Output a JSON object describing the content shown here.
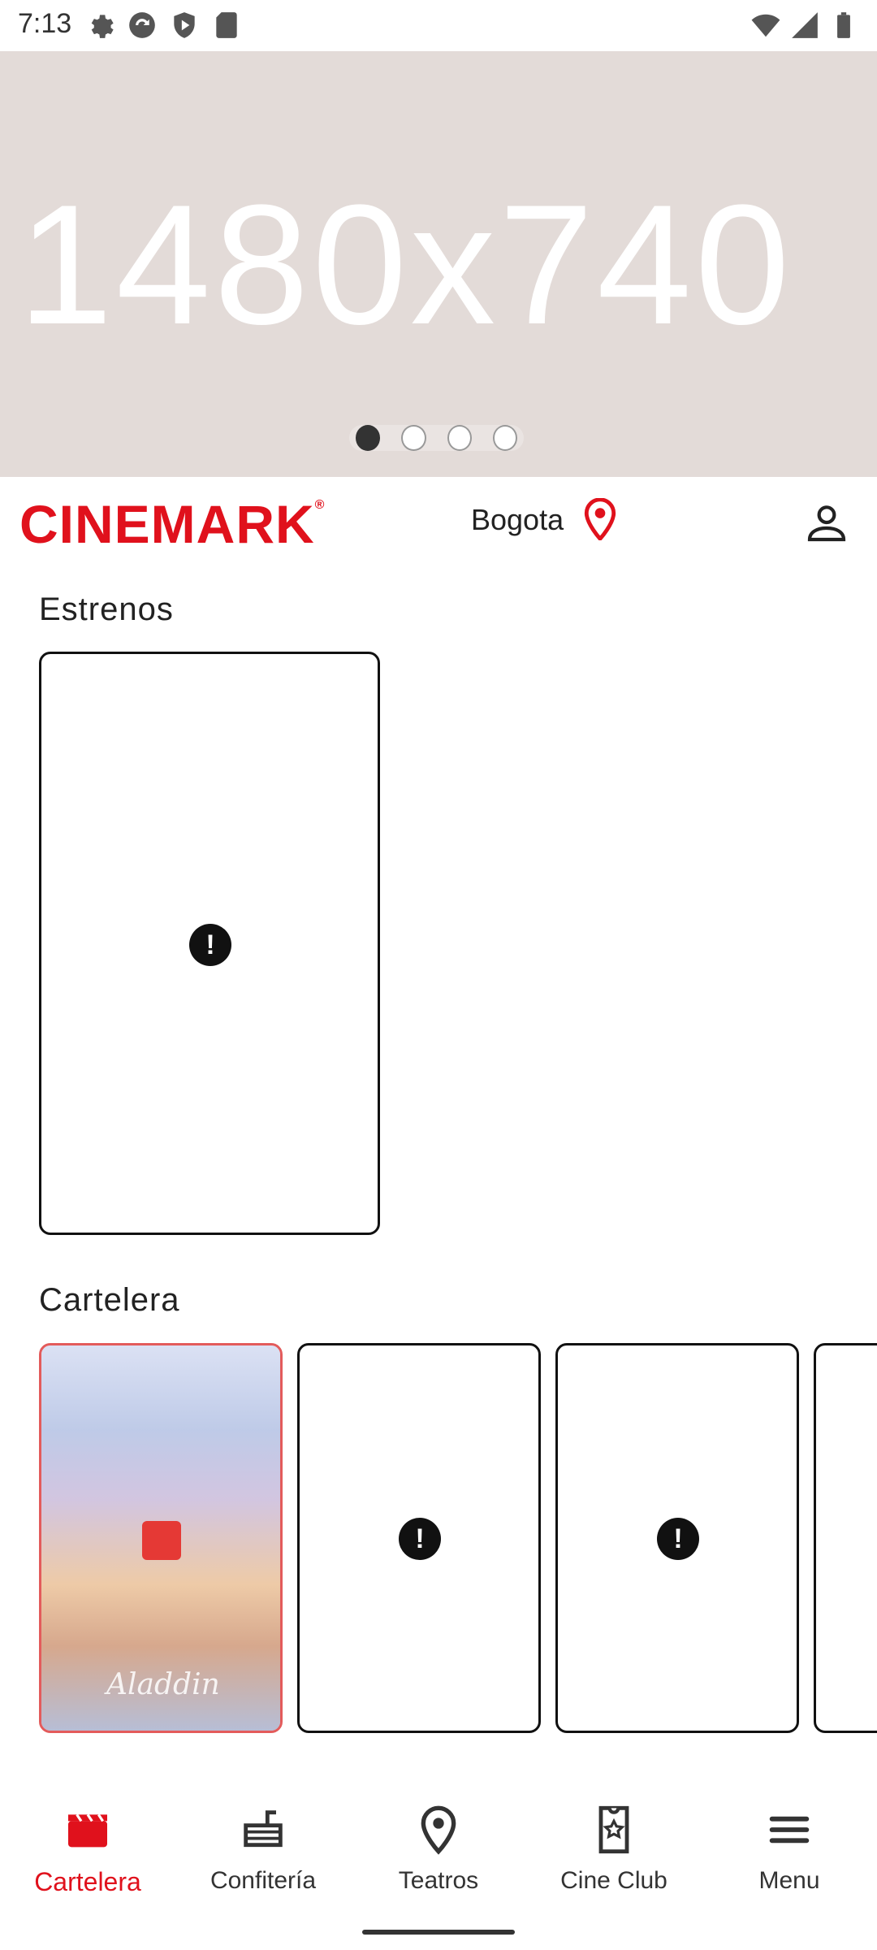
{
  "status": {
    "time": "7:13",
    "left_icons": [
      "gear-icon",
      "sync-icon",
      "shield-play-icon",
      "sd-card-icon"
    ],
    "right_icons": [
      "wifi-icon",
      "cell-signal-icon",
      "battery-icon"
    ]
  },
  "banner": {
    "placeholder_text": "1480x740",
    "dots_count": 4,
    "active_dot_index": 0
  },
  "header": {
    "logo": "CINEMARK",
    "city": "Bogota"
  },
  "sections": {
    "estrenos": {
      "title": "Estrenos"
    },
    "cartelera": {
      "title": "Cartelera",
      "poster_caption": "Aladdin"
    }
  },
  "nav": {
    "items": [
      {
        "label": "Cartelera",
        "icon": "clapperboard-icon"
      },
      {
        "label": "Confitería",
        "icon": "food-icon"
      },
      {
        "label": "Teatros",
        "icon": "map-pin-icon"
      },
      {
        "label": "Cine Club",
        "icon": "ticket-star-icon"
      },
      {
        "label": "Menu",
        "icon": "hamburger-menu-icon"
      }
    ],
    "active_index": 0
  },
  "colors": {
    "brand_red": "#e0111c",
    "banner_bg": "#e3dbd8"
  }
}
